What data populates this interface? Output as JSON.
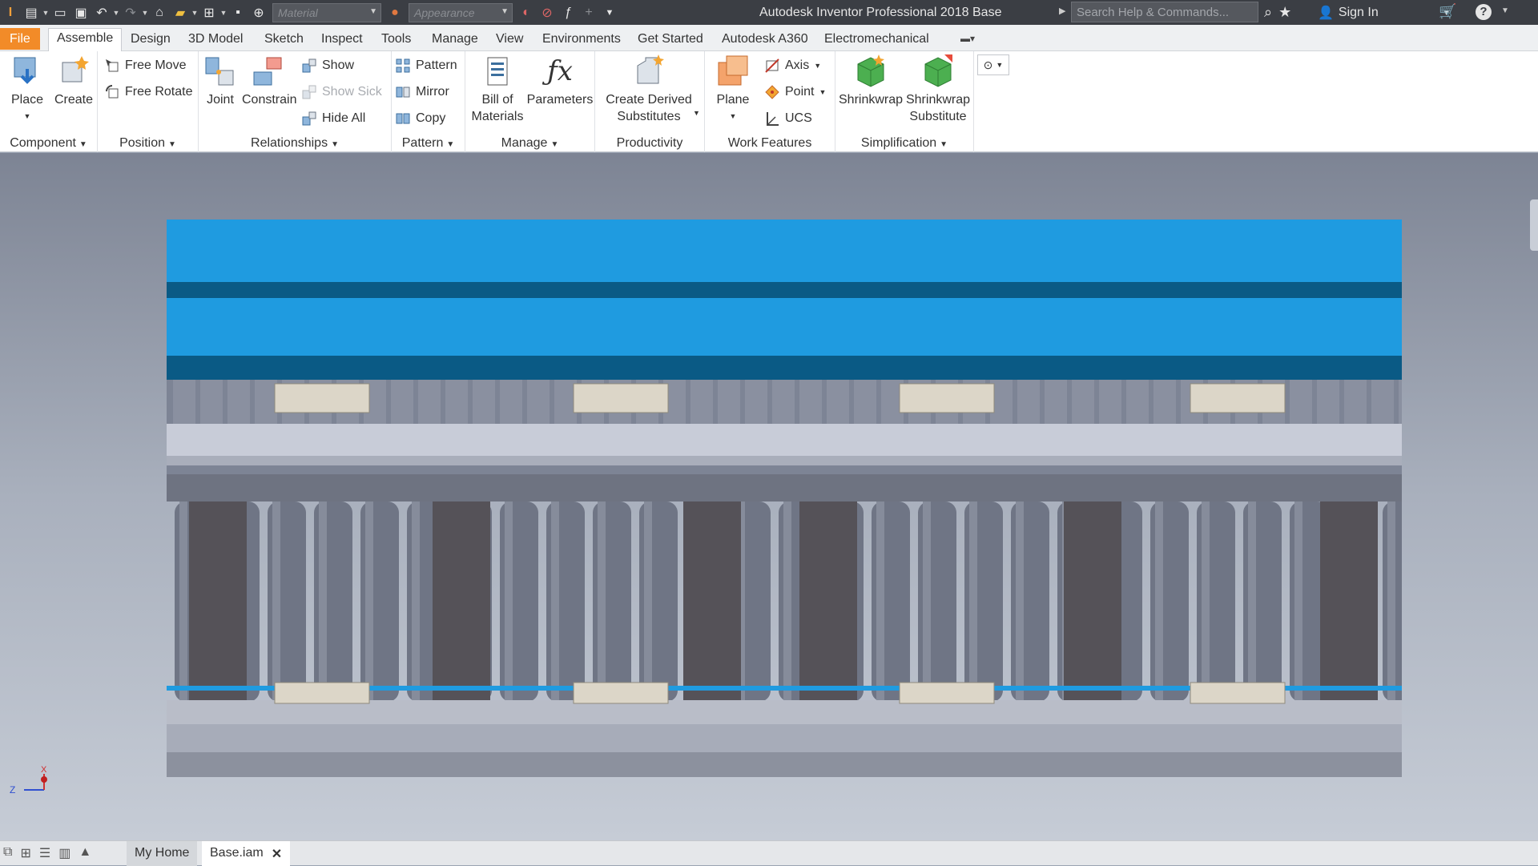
{
  "titlebar": {
    "material_placeholder": "Material",
    "appearance_placeholder": "Appearance",
    "app_title": "Autodesk Inventor Professional 2018",
    "document_name": "Base",
    "search_placeholder": "Search Help & Commands...",
    "sign_in": "Sign In"
  },
  "tabs": [
    "File",
    "Assemble",
    "Design",
    "3D Model",
    "Sketch",
    "Inspect",
    "Tools",
    "Manage",
    "View",
    "Environments",
    "Get Started",
    "Autodesk A360",
    "Electromechanical"
  ],
  "ribbon": {
    "component": {
      "title": "Component",
      "place": "Place",
      "create": "Create"
    },
    "position": {
      "title": "Position",
      "free_move": "Free Move",
      "free_rotate": "Free Rotate"
    },
    "relationships": {
      "title": "Relationships",
      "joint": "Joint",
      "constrain": "Constrain",
      "show": "Show",
      "show_sick": "Show Sick",
      "hide_all": "Hide All"
    },
    "pattern": {
      "title": "Pattern",
      "pattern": "Pattern",
      "mirror": "Mirror",
      "copy": "Copy"
    },
    "manage": {
      "title": "Manage",
      "bom_line1": "Bill of",
      "bom_line2": "Materials",
      "parameters": "Parameters"
    },
    "productivity": {
      "title": "Productivity",
      "derived_line1": "Create Derived",
      "derived_line2": "Substitutes"
    },
    "work_features": {
      "title": "Work Features",
      "plane": "Plane",
      "axis": "Axis",
      "point": "Point",
      "ucs": "UCS"
    },
    "simplification": {
      "title": "Simplification",
      "shrinkwrap": "Shrinkwrap",
      "sw_sub_line1": "Shrinkwrap",
      "sw_sub_line2": "Substitute"
    }
  },
  "viewport": {
    "triad_z": "Z",
    "triad_x": "X",
    "colors": {
      "top_band": "#1f9be0",
      "top_band_dark": "#0a5a85",
      "roller": "#6f7585",
      "plate": "#c8ccd8",
      "block": "#dcd6c8",
      "post": "#555258"
    }
  },
  "statusbar": {
    "home_tab": "My Home",
    "doc_tab": "Base.iam"
  }
}
